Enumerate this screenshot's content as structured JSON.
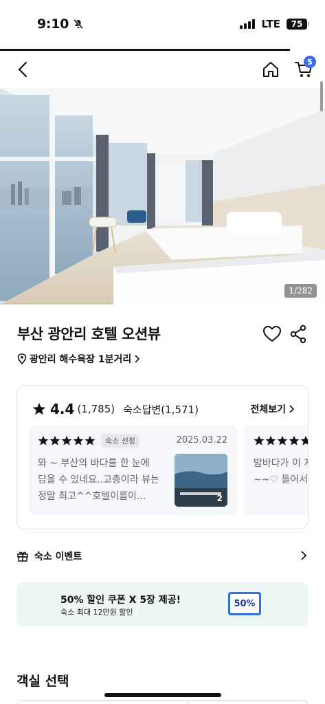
{
  "status_bar": {
    "time": "9:10",
    "network": "LTE",
    "battery": "75"
  },
  "header": {
    "cart_count": "5"
  },
  "photo": {
    "counter": "1/282"
  },
  "hotel": {
    "name": "부산 광안리 호텔 오션뷰",
    "location": "광안리 해수욕장 1분거리"
  },
  "reviews": {
    "rating": "4.4",
    "count": "(1,785)",
    "reply_count": "숙소답변(1,571)",
    "see_all": "전체보기",
    "items": [
      {
        "rating": 5,
        "badge": "숙소 선정",
        "date": "2025.03.22",
        "text": "와 ~ 부산의 바다를 한 눈에 담을 수 있네요..고층이라 뷰는 정말 최고^^호텔이름이...",
        "photo_count": "2"
      },
      {
        "rating": 5,
        "text": "밤바다가 이 지다니~~♡ 들어서자 말"
      }
    ]
  },
  "event": {
    "label": "숙소 이벤트"
  },
  "coupon": {
    "title": "50% 할인 쿠폰 X 5장 제공!",
    "subtitle": "숙소 최대 12만원 할인",
    "ticket_label": "50%"
  },
  "room_section": {
    "title": "객실 선택"
  },
  "colors": {
    "accent": "#3c6cf0",
    "coupon_bg": "#eef7f5",
    "ticket": "#2f6fe9"
  }
}
